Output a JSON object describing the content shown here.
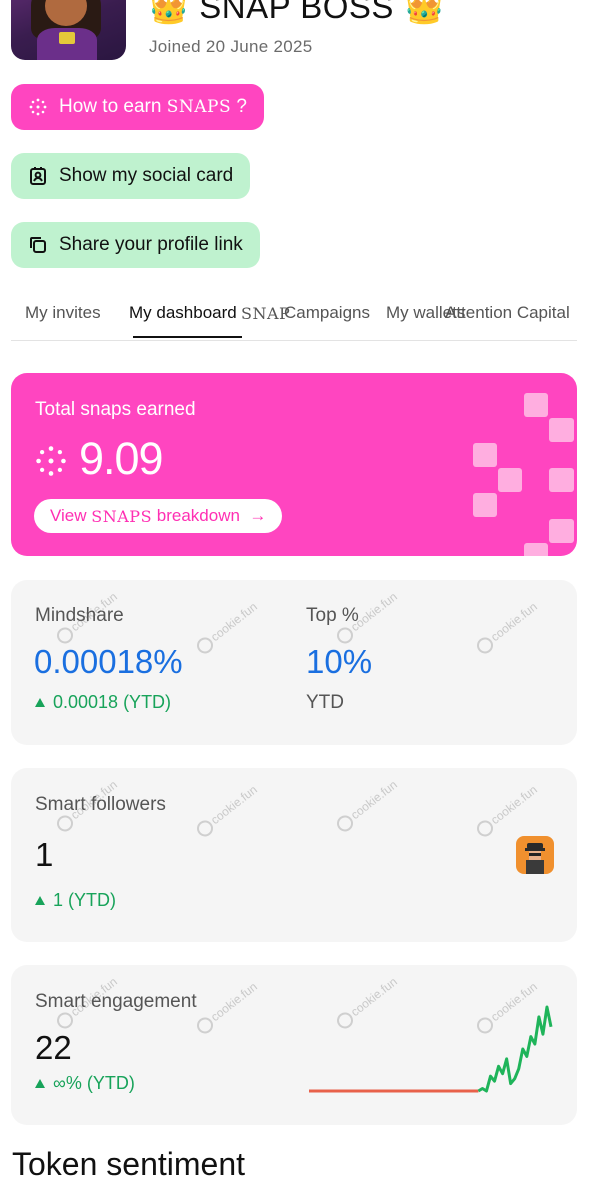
{
  "profile": {
    "name": "👑 SNAP BOSS 👑",
    "joined": "Joined 20 June 2025"
  },
  "actions": {
    "how_to_earn_prefix": "How to earn",
    "how_to_earn_snaps": "SNAPS",
    "how_to_earn_suffix": "?",
    "show_social_card": "Show my social card",
    "share_profile": "Share your profile link"
  },
  "tabs": [
    {
      "label": "My invites",
      "active": false
    },
    {
      "label": "My dashboard",
      "active": true
    },
    {
      "label": "SNAP",
      "active": false
    },
    {
      "label": "Campaigns",
      "active": false
    },
    {
      "label": "My wallets",
      "active": false
    },
    {
      "label": "Attention Capital",
      "active": false
    }
  ],
  "earnings": {
    "label": "Total snaps earned",
    "value": "9.09",
    "breakdown_prefix": "View",
    "breakdown_snaps": "SNAPS",
    "breakdown_suffix": "breakdown",
    "breakdown_arrow": "→"
  },
  "watermark": "cookie.fun",
  "mindshare": {
    "label": "Mindshare",
    "value": "0.00018%",
    "delta": "0.00018 (YTD)",
    "top_label": "Top %",
    "top_value": "10%",
    "top_period": "YTD"
  },
  "smart_followers": {
    "label": "Smart followers",
    "value": "1",
    "delta": "1 (YTD)"
  },
  "smart_engagement": {
    "label": "Smart engagement",
    "value": "22",
    "delta": "∞% (YTD)"
  },
  "sections": {
    "token_sentiment": "Token sentiment"
  },
  "colors": {
    "pink": "#ff45c0",
    "green_pill": "#bff2cf",
    "blue": "#1a6fe0",
    "up_green": "#18a35a",
    "spark_red": "#e8614a",
    "spark_green": "#1fb45a"
  },
  "chart_data": {
    "type": "line",
    "series": [
      {
        "values": [
          0,
          0,
          0,
          0,
          0,
          0,
          0,
          0,
          0,
          0,
          0,
          0,
          0,
          0,
          0,
          0,
          0,
          0,
          0,
          0,
          0,
          0,
          0,
          0,
          0,
          0,
          0,
          0,
          0,
          0,
          0,
          0,
          0,
          0,
          0,
          0,
          0,
          0,
          0,
          0,
          0,
          0,
          0,
          1,
          0,
          6,
          4,
          10,
          7,
          13,
          3,
          5,
          9,
          17,
          14,
          22,
          19,
          30,
          23,
          34,
          26
        ]
      }
    ]
  }
}
